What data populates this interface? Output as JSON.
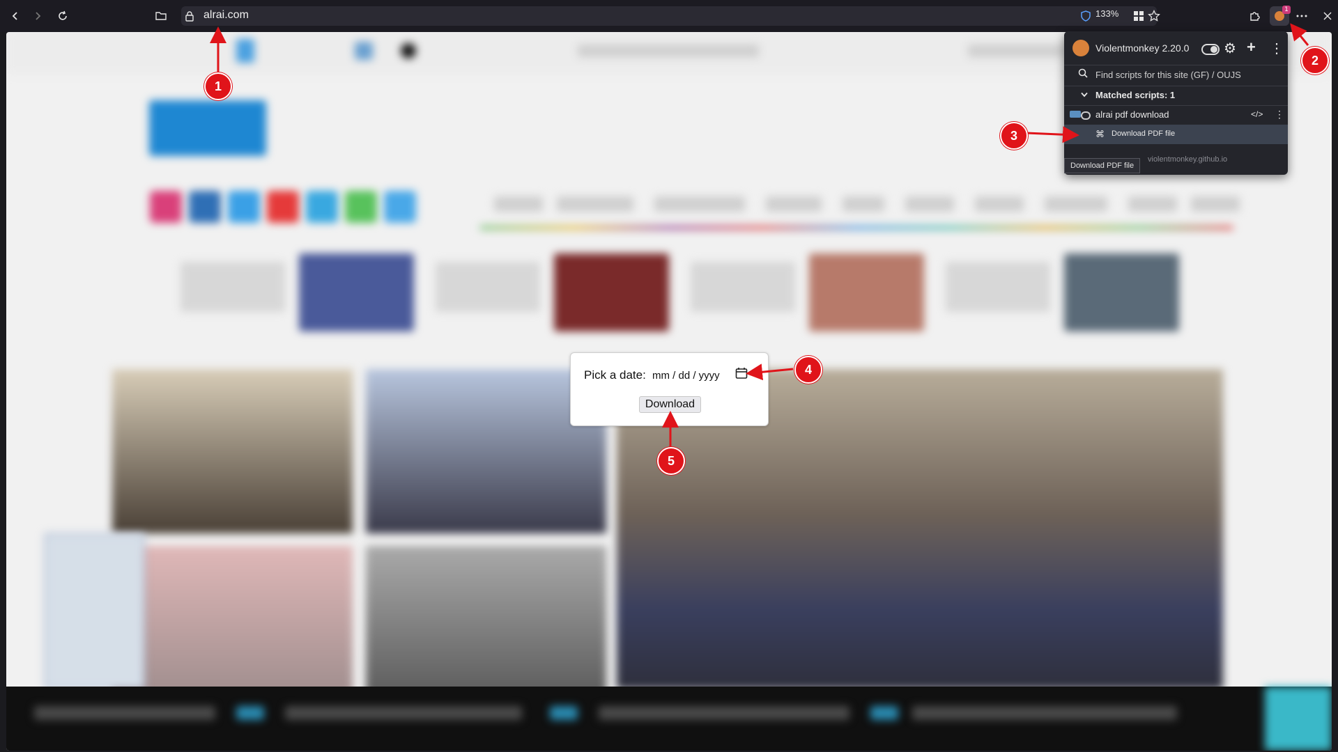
{
  "browser": {
    "url": "alrai.com",
    "zoom": "133%",
    "extension_badge": "1"
  },
  "violentmonkey": {
    "title": "Violentmonkey 2.20.0",
    "find_scripts": "Find scripts for this site (GF)  /  OUJS",
    "matched_scripts": "Matched scripts: 1",
    "script_name": "alrai pdf download",
    "command": "Download PDF file",
    "footer_link": "violentmonkey.github.io",
    "tooltip": "Download PDF file"
  },
  "dialog": {
    "label": "Pick a date:",
    "date_placeholder": "mm / dd / yyyy",
    "button": "Download"
  },
  "annotations": [
    "1",
    "2",
    "3",
    "4",
    "5"
  ],
  "colors": {
    "annotation_red": "#e0141a",
    "toolbar_bg": "#1c1b22",
    "popup_bg": "#24252b",
    "site_blue": "#1e87d2"
  }
}
